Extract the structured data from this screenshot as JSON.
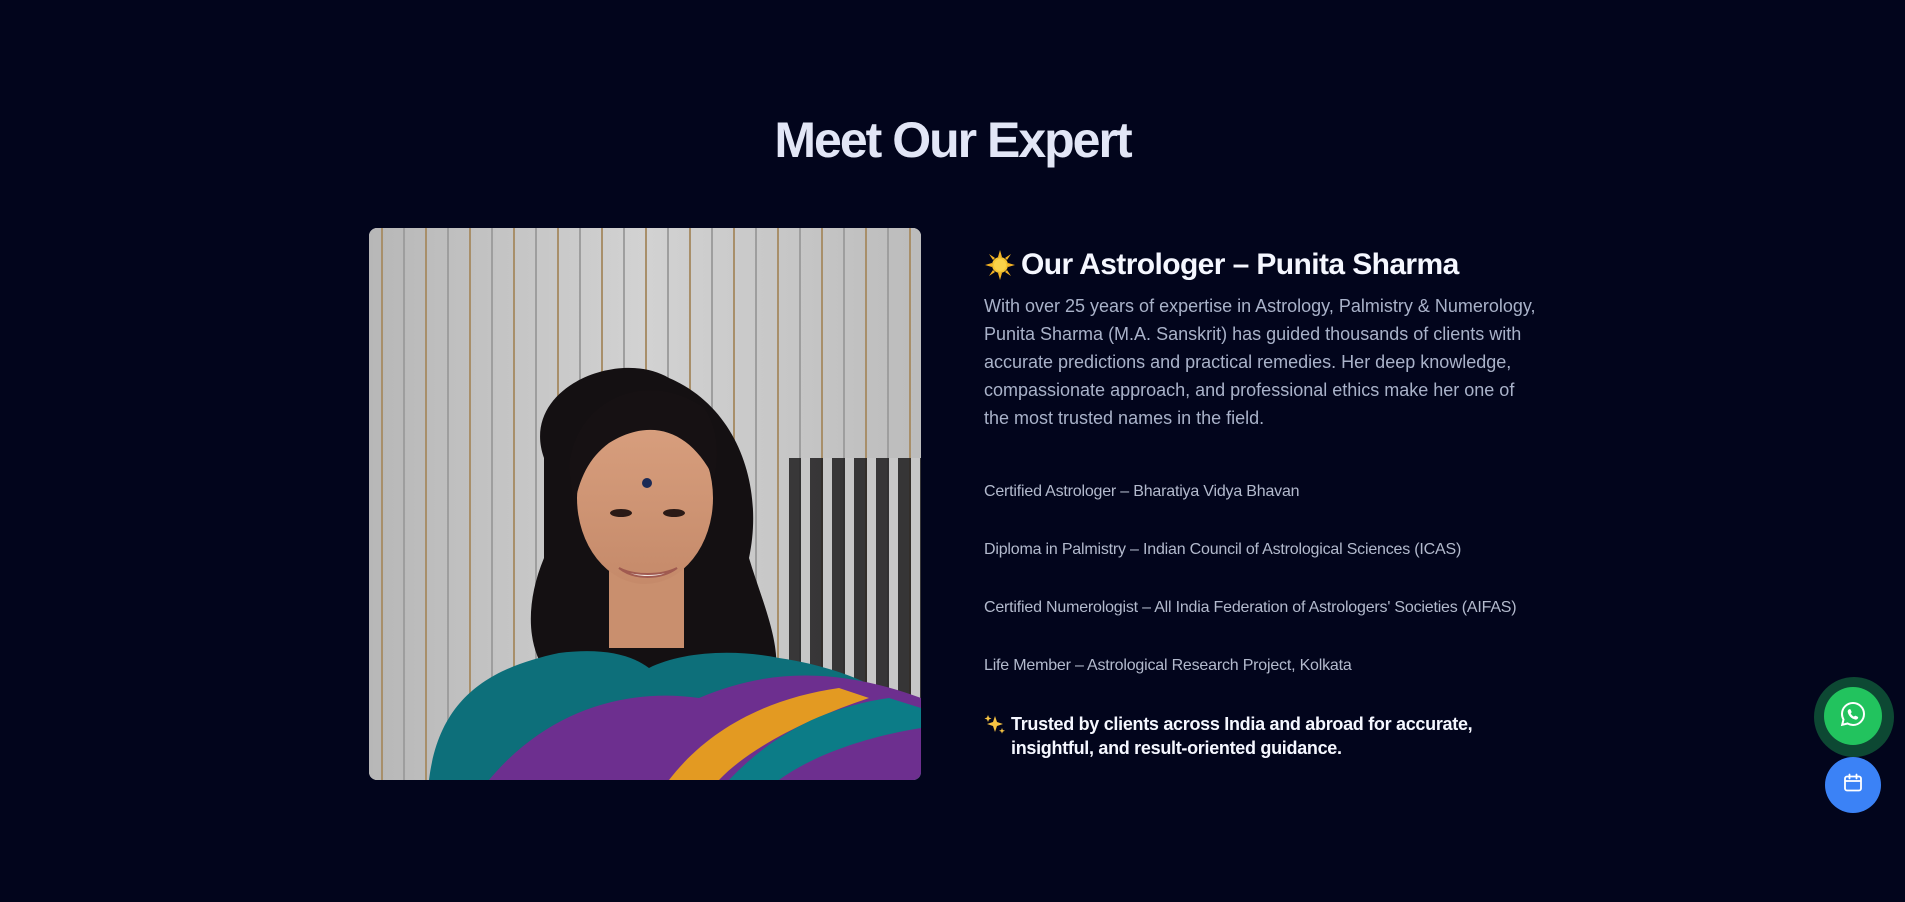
{
  "section": {
    "title": "Meet Our Expert"
  },
  "photo": {
    "alt": "Punita Sharma"
  },
  "astrologer": {
    "heading_icon": "sun-icon",
    "heading": "Our Astrologer – Punita Sharma",
    "bio": "With over 25 years of expertise in Astrology, Palmistry & Numerology, Punita Sharma (M.A. Sanskrit) has guided thousands of clients with accurate predictions and practical remedies. Her deep knowledge, compassionate approach, and professional ethics make her one of the most trusted names in the field.",
    "credentials": [
      "Certified Astrologer – Bharatiya Vidya Bhavan",
      "Diploma in Palmistry – Indian Council of Astrological Sciences (ICAS)",
      "Certified Numerologist – All India Federation of Astrologers' Societies (AIFAS)",
      "Life Member – Astrological Research Project, Kolkata"
    ],
    "trusted_icon": "sparkles-icon",
    "trusted": "Trusted by clients across India and abroad for accurate, insightful, and result-oriented guidance."
  },
  "floating_buttons": {
    "whatsapp_icon": "whatsapp-icon",
    "calendar_icon": "calendar-icon"
  },
  "colors": {
    "background": "#02051c",
    "heading": "#e2e6f6",
    "body_text": "#a9b2c9",
    "whatsapp": "#22c35e",
    "calendar": "#3b82f6"
  }
}
